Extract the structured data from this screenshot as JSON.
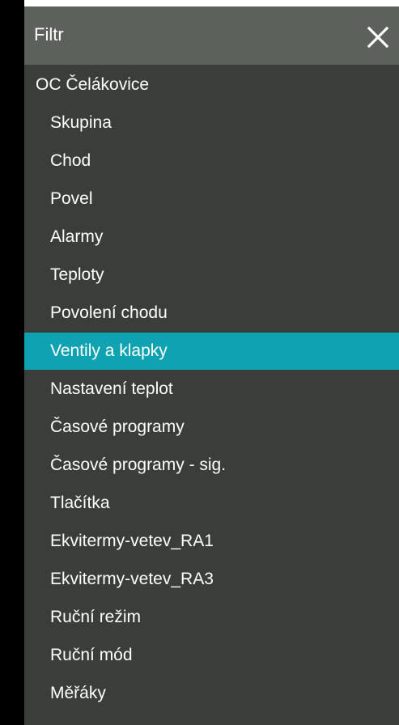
{
  "header": {
    "title": "Filtr",
    "close_icon": "close-icon"
  },
  "colors": {
    "panel_bg": "#3a3d39",
    "header_bg": "#5c615c",
    "selected_bg": "#0fa3b1",
    "text": "#ffffff"
  },
  "list": {
    "root": "OC Čelákovice",
    "selected": "Ventily a klapky",
    "items": [
      "Skupina",
      "Chod",
      "Povel",
      "Alarmy",
      "Teploty",
      "Povolení chodu",
      "Ventily a klapky",
      "Nastavení teplot",
      "Časové programy",
      "Časové programy - sig.",
      "Tlačítka",
      "Ekvitermy-vetev_RA1",
      "Ekvitermy-vetev_RA3",
      "Ruční režim",
      "Ruční mód",
      "Měřáky"
    ]
  }
}
